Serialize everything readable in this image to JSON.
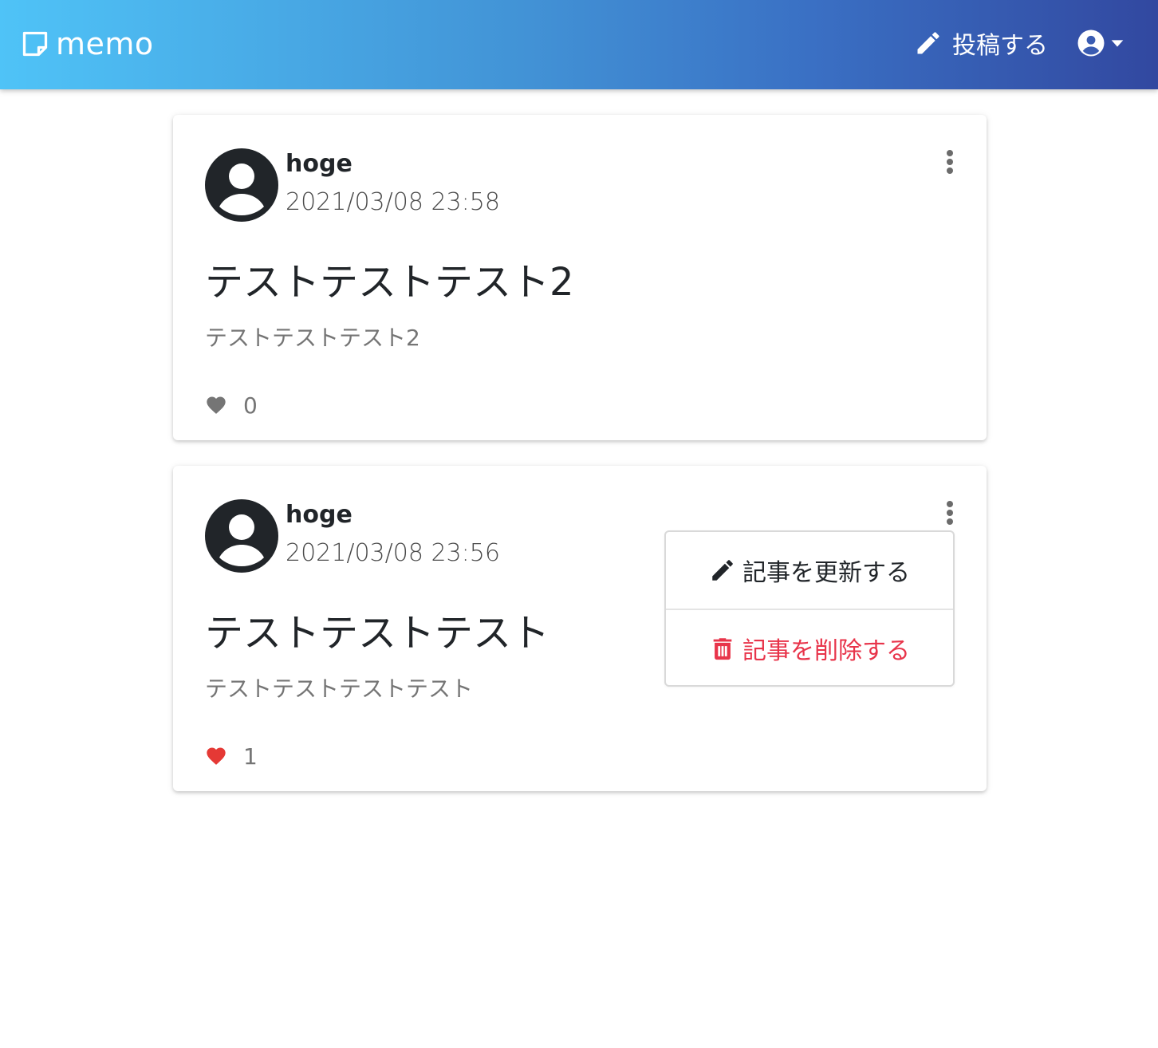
{
  "header": {
    "brand": "memo",
    "post_label": "投稿する"
  },
  "posts": [
    {
      "author": "hoge",
      "date": "2021/03/08 23:58",
      "title": "テストテストテスト2",
      "body": "テストテストテスト2",
      "likes": "0",
      "liked": false
    },
    {
      "author": "hoge",
      "date": "2021/03/08 23:56",
      "title": "テストテストテスト",
      "body": "テストテストテストテスト",
      "likes": "1",
      "liked": true
    }
  ],
  "dropdown": {
    "edit_label": "記事を更新する",
    "delete_label": "記事を削除する"
  },
  "colors": {
    "liked_heart": "#e53935",
    "unliked_heart": "#757575",
    "delete_text": "#e8344a",
    "navbar_gradient_start": "#4fc3f7",
    "navbar_gradient_end": "#3248a0"
  },
  "icons": {
    "brand": "sticky-note-icon",
    "post": "pencil-icon",
    "user": "account-circle-icon",
    "caret": "caret-down-icon",
    "menu": "dots-vertical-icon",
    "like": "heart-icon",
    "edit": "pencil-icon",
    "delete": "trash-icon"
  }
}
